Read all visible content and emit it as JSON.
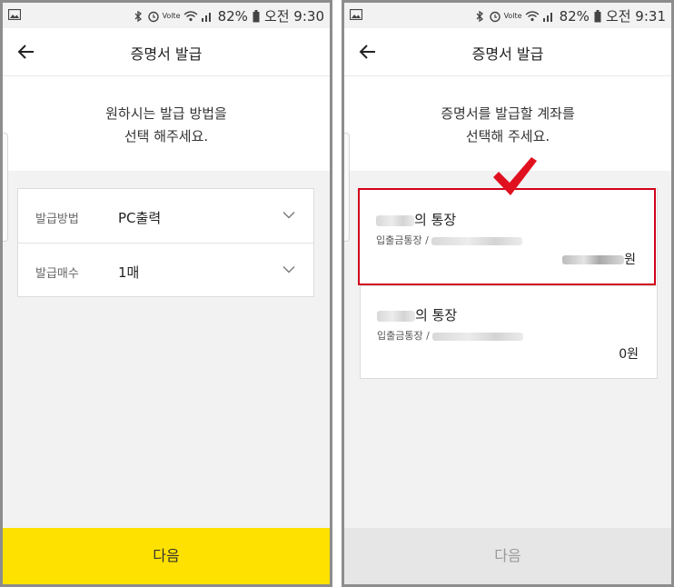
{
  "left_screen": {
    "status": {
      "battery": "82%",
      "time": "오전 9:30",
      "volte": "Volte"
    },
    "title": "증명서 발급",
    "intro": [
      "원하시는 발급 방법을",
      "선택 해주세요."
    ],
    "options": [
      {
        "label": "발급방법",
        "value": "PC출력"
      },
      {
        "label": "발급매수",
        "value": "1매"
      }
    ],
    "cta": "다음"
  },
  "right_screen": {
    "status": {
      "battery": "82%",
      "time": "오전 9:31",
      "volte": "Volte"
    },
    "title": "증명서 발급",
    "intro": [
      "증명서를 발급할 계좌를",
      "선택해 주세요."
    ],
    "accounts": [
      {
        "name_suffix": "의 통장",
        "type_prefix": "입출금통장 /",
        "balance_suffix": "원",
        "selected": true
      },
      {
        "name_suffix": "의 통장",
        "type_prefix": "입출금통장 /",
        "balance": "0원",
        "selected": false
      }
    ],
    "cta": "다음"
  },
  "colors": {
    "accent_yellow": "#ffe100",
    "selection_red": "#d0021b",
    "disabled_button": "#e6e6e6"
  },
  "icons": [
    "gallery-icon",
    "bluetooth-icon",
    "alarm-icon",
    "wifi-icon",
    "signal-icon",
    "battery-icon",
    "back-arrow-icon",
    "chevron-down-icon",
    "red-check-icon"
  ]
}
